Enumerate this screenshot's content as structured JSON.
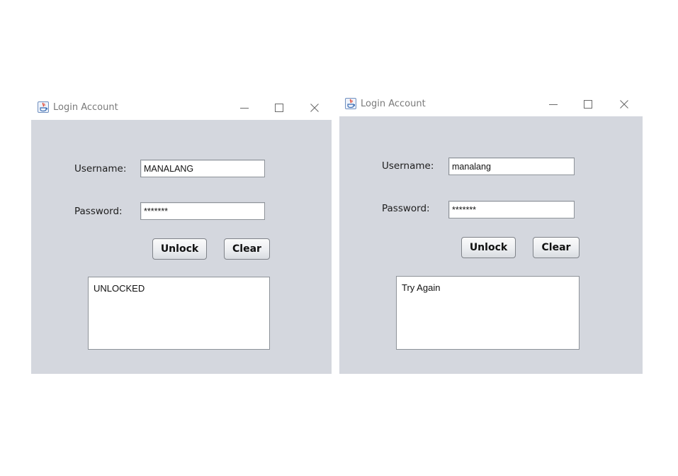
{
  "windows": [
    {
      "title": "Login Account",
      "username_label": "Username:",
      "username_value": "MANALANG",
      "password_label": "Password:",
      "password_value": "*******",
      "unlock_label": "Unlock",
      "clear_label": "Clear",
      "output_text": "UNLOCKED"
    },
    {
      "title": "Login Account",
      "username_label": "Username:",
      "username_value": "manalang",
      "password_label": "Password:",
      "password_value": "*******",
      "unlock_label": "Unlock",
      "clear_label": "Clear",
      "output_text": "Try Again"
    }
  ],
  "icons": {
    "app": "java-cup-icon",
    "minimize": "minimize-icon",
    "maximize": "maximize-icon",
    "close": "close-icon"
  },
  "colors": {
    "panel_background": "#d4d7de",
    "titlebar_background": "#ffffff",
    "title_text": "#7a7a7a"
  }
}
